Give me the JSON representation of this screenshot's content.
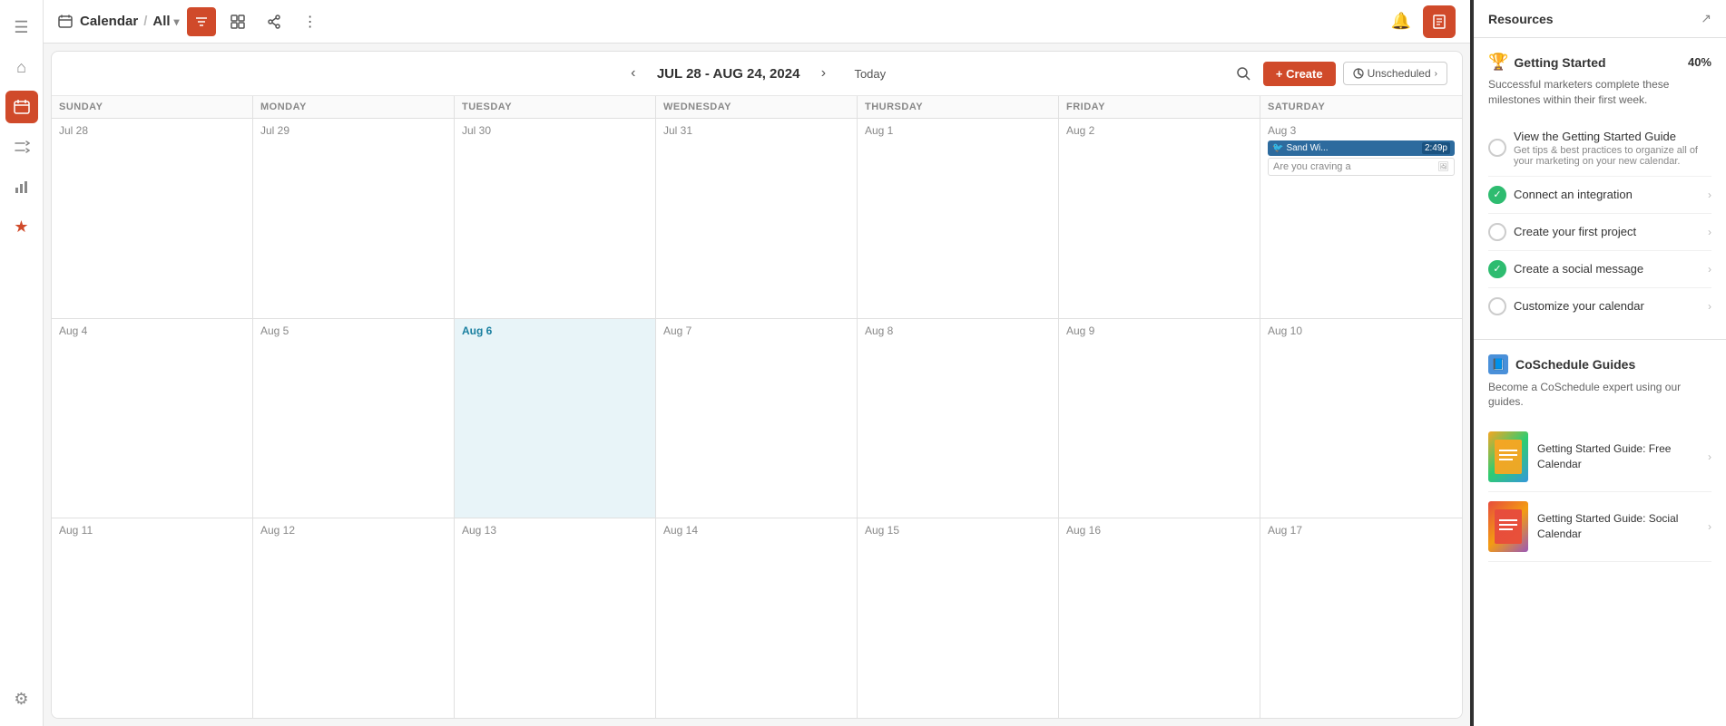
{
  "sidebar": {
    "icons": [
      {
        "name": "menu-icon",
        "symbol": "☰",
        "active": false
      },
      {
        "name": "home-icon",
        "symbol": "⌂",
        "active": false
      },
      {
        "name": "calendar-icon",
        "symbol": "▦",
        "active": true
      },
      {
        "name": "shuffle-icon",
        "symbol": "⇄",
        "active": false
      },
      {
        "name": "chart-icon",
        "symbol": "▐",
        "active": false
      },
      {
        "name": "star-icon",
        "symbol": "★",
        "active": false,
        "starred": true
      }
    ],
    "settings_icon": "⚙"
  },
  "topbar": {
    "calendar_label": "Calendar",
    "slash": "/",
    "all_label": "All",
    "notification_icon": "🔔",
    "book_icon": "📖"
  },
  "calendar": {
    "date_range": "JUL 28 - AUG 24, 2024",
    "today_label": "Today",
    "create_label": "+ Create",
    "unscheduled_label": "Unscheduled",
    "day_headers": [
      "SUNDAY",
      "MONDAY",
      "TUESDAY",
      "WEDNESDAY",
      "THURSDAY",
      "FRIDAY",
      "SATURDAY"
    ],
    "weeks": [
      {
        "days": [
          {
            "num": "Jul 28",
            "today": false,
            "events": []
          },
          {
            "num": "Jul 29",
            "today": false,
            "events": []
          },
          {
            "num": "Jul 30",
            "today": false,
            "events": []
          },
          {
            "num": "Jul 31",
            "today": false,
            "events": []
          },
          {
            "num": "Aug 1",
            "today": false,
            "events": []
          },
          {
            "num": "Aug 2",
            "today": false,
            "events": []
          },
          {
            "num": "Aug 3",
            "today": false,
            "events": [
              {
                "label": "Sand Wi... 2:49p",
                "preview": "Are you craving a"
              }
            ]
          }
        ]
      },
      {
        "days": [
          {
            "num": "Aug 4",
            "today": false,
            "events": []
          },
          {
            "num": "Aug 5",
            "today": false,
            "events": []
          },
          {
            "num": "Aug 6",
            "today": true,
            "events": []
          },
          {
            "num": "Aug 7",
            "today": false,
            "events": []
          },
          {
            "num": "Aug 8",
            "today": false,
            "events": []
          },
          {
            "num": "Aug 9",
            "today": false,
            "events": []
          },
          {
            "num": "Aug 10",
            "today": false,
            "events": []
          }
        ]
      },
      {
        "days": [
          {
            "num": "Aug 11",
            "today": false,
            "events": []
          },
          {
            "num": "Aug 12",
            "today": false,
            "events": []
          },
          {
            "num": "Aug 13",
            "today": false,
            "events": []
          },
          {
            "num": "Aug 14",
            "today": false,
            "events": []
          },
          {
            "num": "Aug 15",
            "today": false,
            "events": []
          },
          {
            "num": "Aug 16",
            "today": false,
            "events": []
          },
          {
            "num": "Aug 17",
            "today": false,
            "events": []
          }
        ]
      }
    ]
  },
  "resources": {
    "title": "Resources",
    "external_icon": "↗",
    "getting_started": {
      "title": "Getting Started",
      "percent": "40%",
      "subtitle": "Successful marketers complete these milestones within their first week.",
      "milestones": [
        {
          "label": "View the Getting Started Guide",
          "done": false,
          "description": "Get tips & best practices to organize all of your marketing on your new calendar."
        },
        {
          "label": "Connect an integration",
          "done": true
        },
        {
          "label": "Create your first project",
          "done": false
        },
        {
          "label": "Create a social message",
          "done": true
        },
        {
          "label": "Customize your calendar",
          "done": false
        }
      ]
    },
    "guides": {
      "title": "CoSchedule Guides",
      "subtitle": "Become a CoSchedule expert using our guides.",
      "items": [
        {
          "label": "Getting Started Guide: Free Calendar"
        },
        {
          "label": "Getting Started Guide: Social Calendar"
        }
      ]
    }
  }
}
